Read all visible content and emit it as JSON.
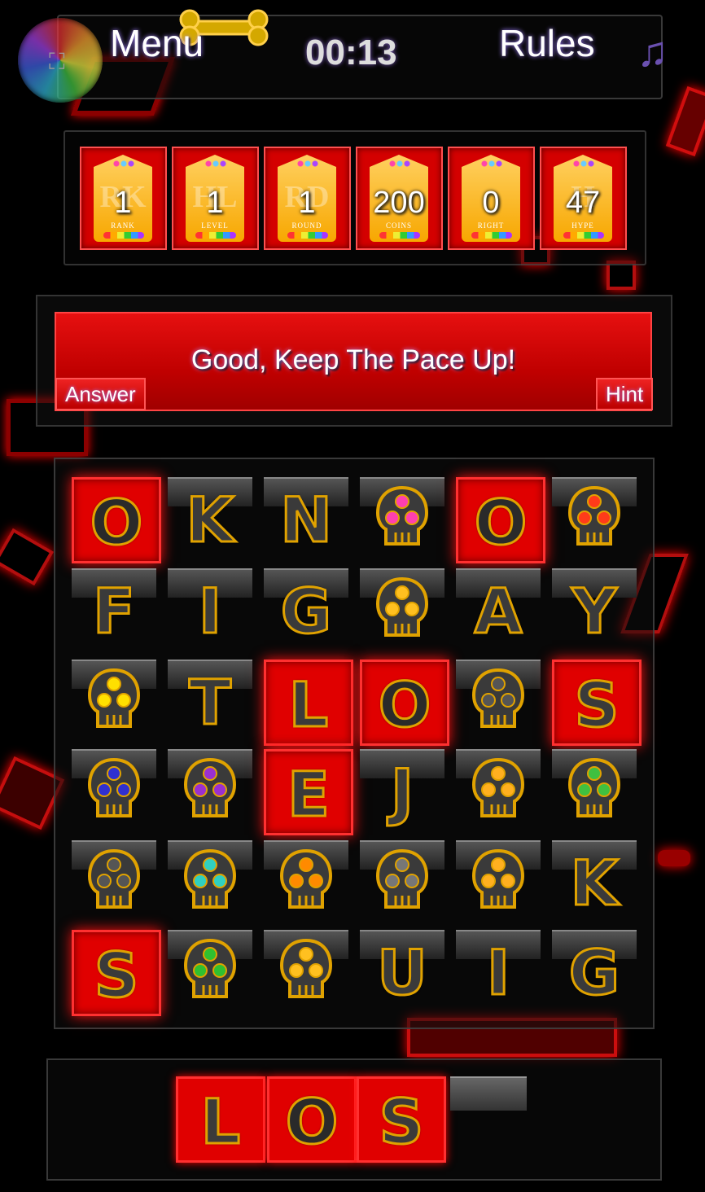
{
  "header": {
    "menu_label": "Menu",
    "timer": "00:13",
    "rules_label": "Rules",
    "fullscreen_icon": "fullscreen-icon",
    "music_icon": "music-note-icon"
  },
  "stats": [
    {
      "letters": "RK",
      "value": "1",
      "label": "RANK"
    },
    {
      "letters": "HL",
      "value": "1",
      "label": "LEVEL"
    },
    {
      "letters": "RD",
      "value": "1",
      "label": "ROUND"
    },
    {
      "letters": "",
      "value": "200",
      "label": "COINS"
    },
    {
      "letters": "",
      "value": "0",
      "label": "RIGHT"
    },
    {
      "letters": "H",
      "value": "47",
      "label": "HYPE"
    }
  ],
  "message": {
    "text": "Good, Keep The Pace Up!",
    "answer_label": "Answer",
    "hint_label": "Hint"
  },
  "board": {
    "rows": [
      [
        {
          "t": "letter",
          "v": "O",
          "sel": true
        },
        {
          "t": "letter",
          "v": "K"
        },
        {
          "t": "letter",
          "v": "N"
        },
        {
          "t": "skull",
          "c": "#ff3fb0"
        },
        {
          "t": "letter",
          "v": "O",
          "sel": true
        },
        {
          "t": "skull",
          "c": "#ff3b1a"
        }
      ],
      [
        {
          "t": "letter",
          "v": "F"
        },
        {
          "t": "letter",
          "v": "I"
        },
        {
          "t": "letter",
          "v": "G"
        },
        {
          "t": "skull",
          "c": "#ffc020"
        },
        {
          "t": "letter",
          "v": "A"
        },
        {
          "t": "letter",
          "v": "Y"
        }
      ],
      [
        {
          "t": "skull",
          "c": "#ffe000"
        },
        {
          "t": "letter",
          "v": "T"
        },
        {
          "t": "letter",
          "v": "L",
          "sel": true
        },
        {
          "t": "letter",
          "v": "O",
          "sel": true
        },
        {
          "t": "skull",
          "c": "#555"
        },
        {
          "t": "letter",
          "v": "S",
          "sel": true
        }
      ],
      [
        {
          "t": "skull",
          "c": "#3030d0"
        },
        {
          "t": "skull",
          "c": "#9a30d0"
        },
        {
          "t": "letter",
          "v": "E",
          "sel": true
        },
        {
          "t": "letter",
          "v": "J"
        },
        {
          "t": "skull",
          "c": "#ffb020"
        },
        {
          "t": "skull",
          "c": "#40c040"
        }
      ],
      [
        {
          "t": "skull",
          "c": "#555"
        },
        {
          "t": "skull",
          "c": "#30d0c0"
        },
        {
          "t": "skull",
          "c": "#ff8a00"
        },
        {
          "t": "skull",
          "c": "#777"
        },
        {
          "t": "skull",
          "c": "#ffb020"
        },
        {
          "t": "letter",
          "v": "K"
        }
      ],
      [
        {
          "t": "letter",
          "v": "S",
          "sel": true
        },
        {
          "t": "skull",
          "c": "#30c030"
        },
        {
          "t": "skull",
          "c": "#ffc020"
        },
        {
          "t": "letter",
          "v": "U"
        },
        {
          "t": "letter",
          "v": "I"
        },
        {
          "t": "letter",
          "v": "G"
        }
      ]
    ]
  },
  "answer": {
    "slots": [
      "L",
      "O",
      "S",
      ""
    ]
  },
  "colors": {
    "accent_red": "#e00000",
    "gold": "#e0a200"
  }
}
